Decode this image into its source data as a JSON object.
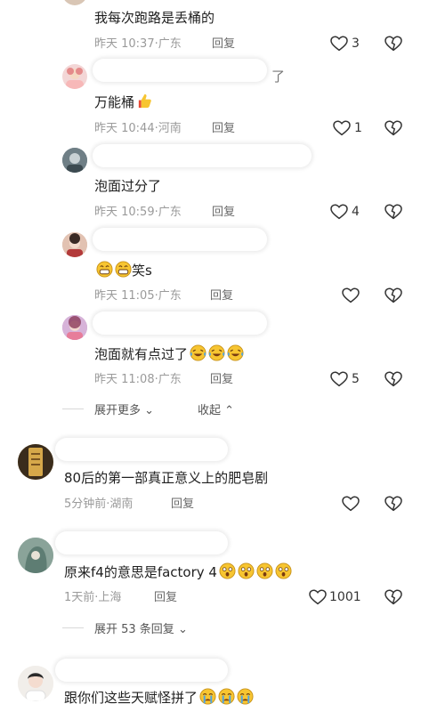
{
  "comments": [
    {
      "text": "我每次跑路是丢桶的",
      "time": "昨天 10:37",
      "location": "广东",
      "reply": "回复",
      "likes": "3"
    },
    {
      "text": "万能桶",
      "time": "昨天 10:44",
      "location": "河南",
      "reply": "回复",
      "likes": "1",
      "name_tail": "了"
    },
    {
      "text": "泡面过分了",
      "time": "昨天 10:59",
      "location": "广东",
      "reply": "回复",
      "likes": "4"
    },
    {
      "text": "笑s",
      "time": "昨天 11:05",
      "location": "广东",
      "reply": "回复",
      "likes": ""
    },
    {
      "text": "泡面就有点过了",
      "time": "昨天 11:08",
      "location": "广东",
      "reply": "回复",
      "likes": "5"
    },
    {
      "text": "80后的第一部真正意义上的肥皂剧",
      "time": "5分钟前",
      "location": "湖南",
      "reply": "回复",
      "likes": ""
    },
    {
      "text": "原来f4的意思是factory 4",
      "time": "1天前",
      "location": "上海",
      "reply": "回复",
      "likes": "1001"
    },
    {
      "text": "跟你们这些天赋怪拼了",
      "time": "",
      "location": "",
      "reply": "",
      "likes": ""
    }
  ],
  "expand_more": "展开更多",
  "collapse": "收起",
  "expand_replies": "展开 53 条回复",
  "colors": {
    "meta": "#9a9a9a",
    "emoji_yellow": "#f7c531",
    "heart_outline": "#333333"
  }
}
